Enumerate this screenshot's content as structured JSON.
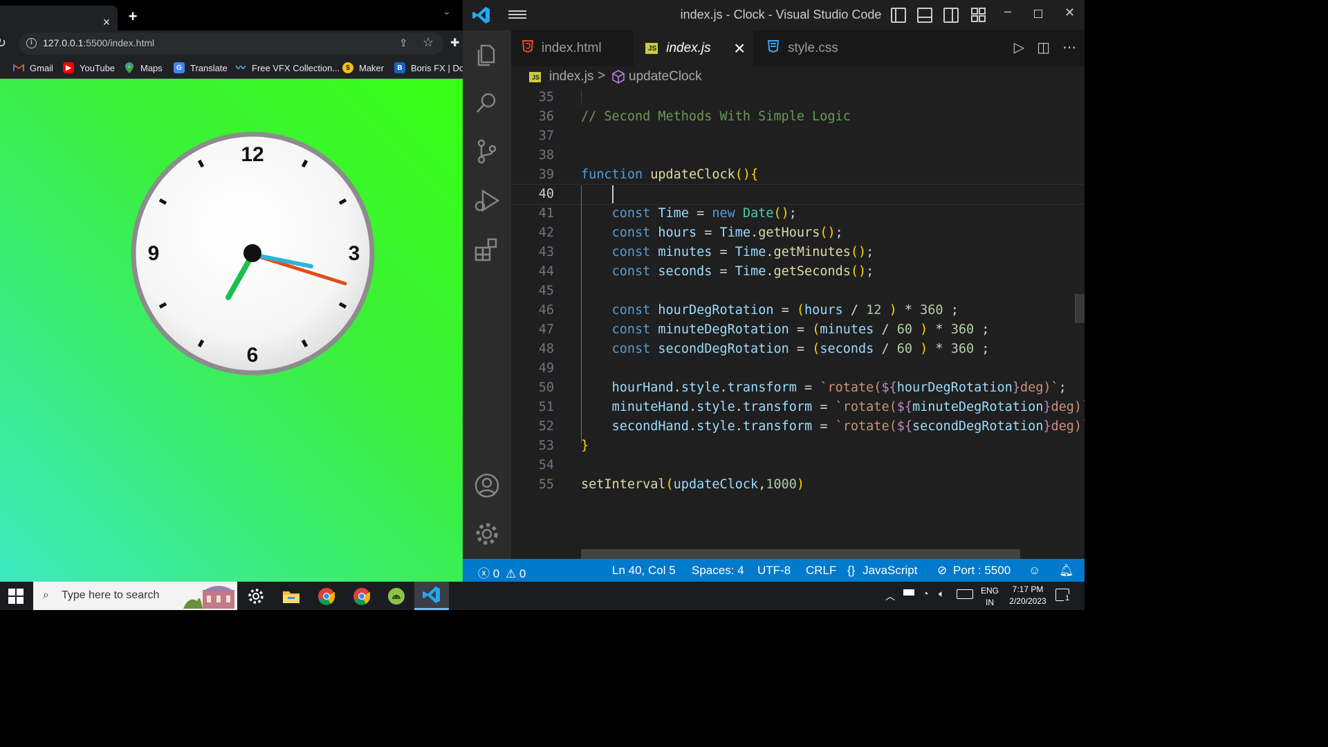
{
  "browser": {
    "tab_close": "×",
    "new_tab": "+",
    "url_host": "127.0.0.1",
    "url_rest": ":5500/index.html",
    "bookmarks": [
      {
        "label": "Gmail",
        "icon": "gmail-icon"
      },
      {
        "label": "YouTube",
        "icon": "youtube-icon"
      },
      {
        "label": "Maps",
        "icon": "maps-icon"
      },
      {
        "label": "Translate",
        "icon": "translate-icon"
      },
      {
        "label": "Free VFX Collection...",
        "icon": "vfx-icon"
      },
      {
        "label": "Maker",
        "icon": "maker-icon"
      },
      {
        "label": "Boris FX | Dow",
        "icon": "borisfx-icon"
      }
    ],
    "page": {
      "gradient_colors": [
        "#39ff14",
        "#3de9c0"
      ],
      "clock": {
        "numbers": [
          "12",
          "3",
          "6",
          "9"
        ],
        "hour_hand_color": "#1ac14e",
        "minute_hand_color": "#29b6d6",
        "second_hand_color": "#e24c16"
      }
    }
  },
  "vscode": {
    "window_title": "index.js - Clock - Visual Studio Code",
    "tabs": [
      {
        "label": "index.html",
        "icon": "html-file-icon",
        "active": false
      },
      {
        "label": "index.js",
        "icon": "js-file-icon",
        "active": true
      },
      {
        "label": "style.css",
        "icon": "css-file-icon",
        "active": false
      }
    ],
    "tab_close": "×",
    "breadcrumb": {
      "file": "index.js",
      "js_badge": "JS",
      "separator": ">",
      "symbol": "updateClock"
    },
    "lines": [
      {
        "n": "35",
        "code": ""
      },
      {
        "n": "36",
        "code": "// Second Methods With Simple Logic"
      },
      {
        "n": "37",
        "code": ""
      },
      {
        "n": "38",
        "code": ""
      },
      {
        "n": "39",
        "code": "function updateClock(){"
      },
      {
        "n": "40",
        "code": ""
      },
      {
        "n": "41",
        "code": "    const Time = new Date();"
      },
      {
        "n": "42",
        "code": "    const hours = Time.getHours();"
      },
      {
        "n": "43",
        "code": "    const minutes = Time.getMinutes();"
      },
      {
        "n": "44",
        "code": "    const seconds = Time.getSeconds();"
      },
      {
        "n": "45",
        "code": ""
      },
      {
        "n": "46",
        "code": "    const hourDegRotation = (hours / 12 ) * 360 ;"
      },
      {
        "n": "47",
        "code": "    const minuteDegRotation = (minutes / 60 ) * 360 ;"
      },
      {
        "n": "48",
        "code": "    const secondDegRotation = (seconds / 60 ) * 360 ;"
      },
      {
        "n": "49",
        "code": ""
      },
      {
        "n": "50",
        "code": "    hourHand.style.transform = `rotate(${hourDegRotation}deg)`;"
      },
      {
        "n": "51",
        "code": "    minuteHand.style.transform = `rotate(${minuteDegRotation}deg)`;"
      },
      {
        "n": "52",
        "code": "    secondHand.style.transform = `rotate(${secondDegRotation}deg)`;"
      },
      {
        "n": "53",
        "code": "}"
      },
      {
        "n": "54",
        "code": ""
      },
      {
        "n": "55",
        "code": "setInterval(updateClock,1000)"
      }
    ],
    "current_line": "40",
    "status": {
      "errors": "0",
      "warnings": "0",
      "position": "Ln 40, Col 5",
      "spaces": "Spaces: 4",
      "encoding": "UTF-8",
      "eol": "CRLF",
      "language": "JavaScript",
      "port": "Port : 5500"
    },
    "accent_color": "#007acc"
  },
  "taskbar": {
    "search_placeholder": "Type here to search",
    "apps": [
      "settings-icon",
      "file-explorer-icon",
      "chrome-icon",
      "chrome-icon",
      "android-studio-icon",
      "vscode-icon"
    ],
    "lang_top": "ENG",
    "lang_bottom": "IN",
    "time": "7:17 PM",
    "date": "2/20/2023",
    "notification_count": "1"
  }
}
